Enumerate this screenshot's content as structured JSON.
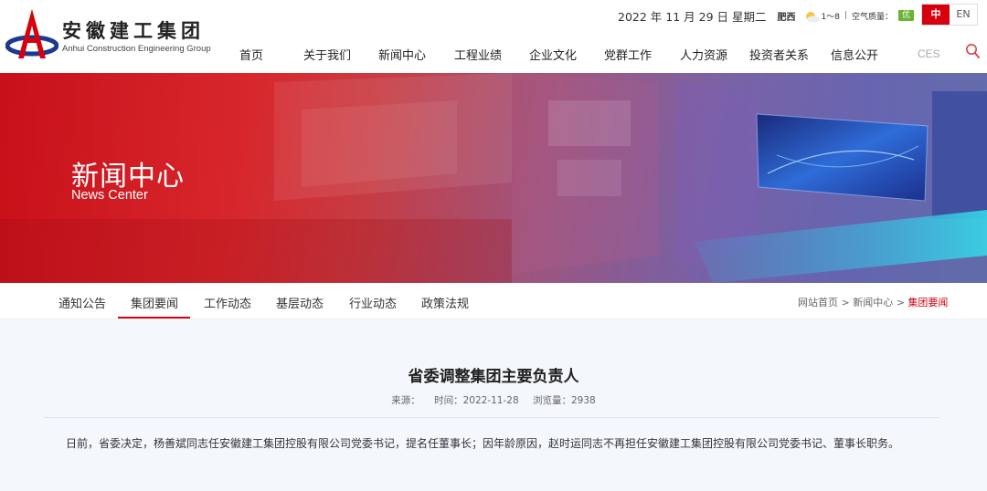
{
  "header": {
    "logo_cn": "安徽建工集团",
    "logo_en": "Anhui Construction Engineering Group",
    "date": "2022 年 11 月 29 日 星期二",
    "city": "肥西",
    "temp": "1～8",
    "air_quality_label": "空气质量：",
    "air_quality_value": "优",
    "lang_zh": "中",
    "lang_en": "EN"
  },
  "nav": {
    "items": [
      "首页",
      "关于我们",
      "新闻中心",
      "工程业绩",
      "企业文化",
      "党群工作",
      "人力资源",
      "投资者关系",
      "信息公开"
    ],
    "ces": "CES"
  },
  "banner": {
    "title": "新闻中心",
    "subtitle": "News Center"
  },
  "subnav": {
    "items": [
      "通知公告",
      "集团要闻",
      "工作动态",
      "基层动态",
      "行业动态",
      "政策法规"
    ],
    "active_index": 1
  },
  "breadcrumb": {
    "home": "网站首页",
    "sep": ">",
    "section": "新闻中心",
    "current": "集团要闻"
  },
  "article": {
    "title": "省委调整集团主要负责人",
    "source_label": "来源：",
    "source": "",
    "time_label": "时间：",
    "time": "2022-11-28",
    "views_label": "浏览量：",
    "views": "2938",
    "body": "日前，省委决定，杨善斌同志任安徽建工集团控股有限公司党委书记，提名任董事长；因年龄原因，赵时运同志不再担任安徽建工集团控股有限公司党委书记、董事长职务。"
  },
  "colors": {
    "accent": "#d7000f",
    "logo_red": "#d7000f",
    "logo_blue": "#1b3a8f"
  }
}
